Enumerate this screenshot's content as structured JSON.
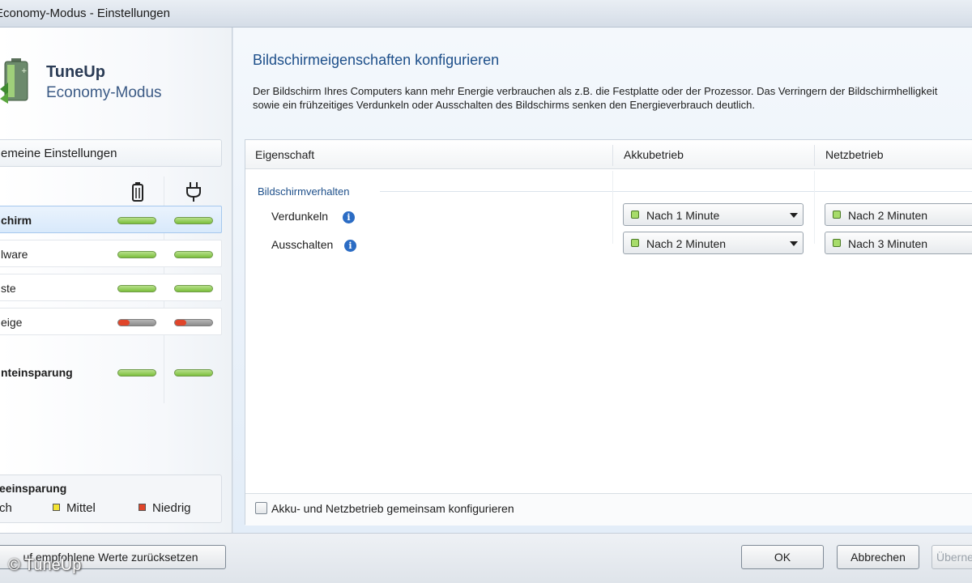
{
  "window": {
    "title": "Economy-Modus - Einstellungen"
  },
  "brand": {
    "name": "TuneUp",
    "subtitle": "Economy-Modus",
    "logo_icon": "battery-leaf-icon"
  },
  "sidebar": {
    "general_label": "emeine Einstellungen",
    "columns": [
      {
        "icon": "battery-icon",
        "glyph": "▯"
      },
      {
        "icon": "power-plug-icon",
        "glyph": "⏚"
      }
    ],
    "items": [
      {
        "label": "chirm",
        "battery": "high",
        "mains": "high",
        "selected": true
      },
      {
        "label": "lware",
        "battery": "high",
        "mains": "high",
        "selected": false
      },
      {
        "label": "ste",
        "battery": "high",
        "mains": "high",
        "selected": false
      },
      {
        "label": "eige",
        "battery": "low",
        "mains": "low",
        "selected": false
      }
    ],
    "summary": {
      "label": "nteinsparung",
      "battery": "high",
      "mains": "high"
    },
    "legend": {
      "title": "eeinsparung",
      "items": [
        {
          "label": "ch",
          "color": "#7cbf3c"
        },
        {
          "label": "Mittel",
          "color": "#f2e333"
        },
        {
          "label": "Niedrig",
          "color": "#e0452a"
        }
      ]
    }
  },
  "main": {
    "title": "Bildschirmeigenschaften konfigurieren",
    "description": "Der Bildschirm Ihres Computers kann mehr Energie verbrauchen als z.B. die Festplatte oder der Prozessor. Das Verringern der Bildschirmhelligkeit sowie ein frühzeitiges Verdunkeln oder Ausschalten des Bildschirms senken den Energieverbrauch deutlich.",
    "table": {
      "headers": [
        "Eigenschaft",
        "Akkubetrieb",
        "Netzbetrieb"
      ],
      "group": "Bildschirmverhalten",
      "rows": [
        {
          "label": "Verdunkeln",
          "battery": "Nach 1 Minute",
          "mains": "Nach 2 Minuten"
        },
        {
          "label": "Ausschalten",
          "battery": "Nach 2 Minuten",
          "mains": "Nach 3 Minuten"
        }
      ]
    },
    "joint_checkbox": {
      "label": "Akku- und Netzbetrieb gemeinsam konfigurieren",
      "checked": false
    }
  },
  "buttons": {
    "reset": "uf empfohlene Werte zurücksetzen",
    "ok": "OK",
    "cancel": "Abbrechen",
    "apply": "Überne"
  },
  "watermark": "© TuneUp"
}
